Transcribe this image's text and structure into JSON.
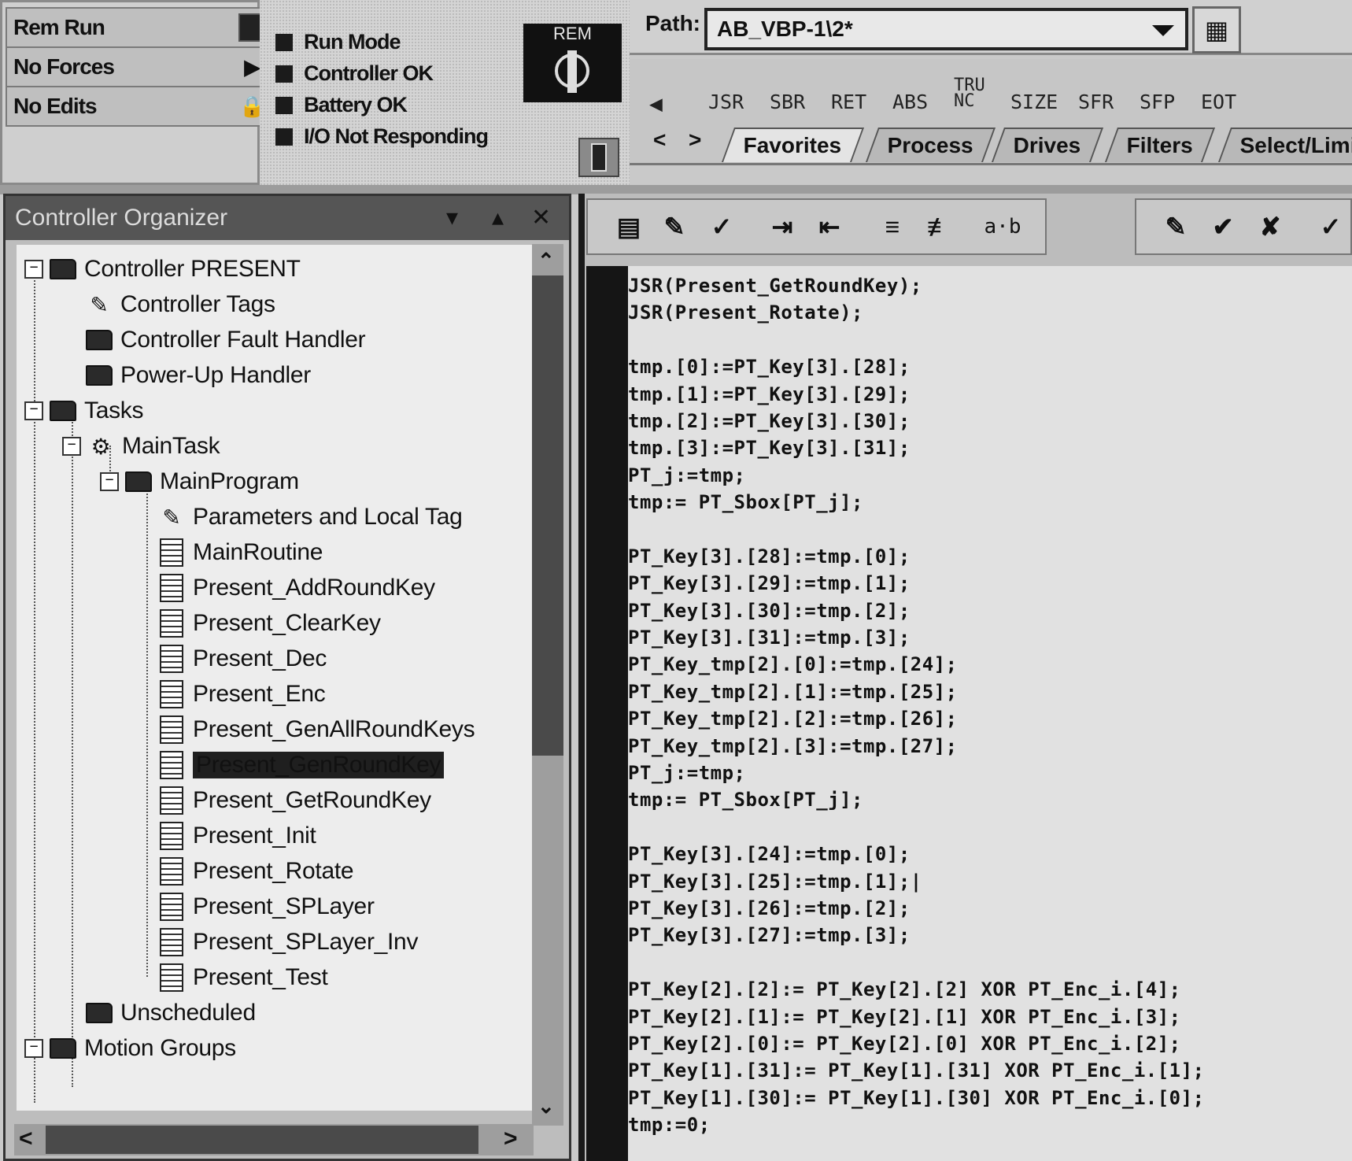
{
  "status": {
    "rem_run": "Rem Run",
    "no_forces": "No Forces",
    "no_edits": "No Edits",
    "indicators": [
      "Run Mode",
      "Controller OK",
      "Battery OK",
      "I/O Not Responding"
    ],
    "keyswitch_label": "REM"
  },
  "path": {
    "label": "Path:",
    "value": "AB_VBP-1\\2*"
  },
  "instructions": [
    "JSR",
    "SBR",
    "RET",
    "ABS",
    "SIZE",
    "SFR",
    "SFP",
    "EOT"
  ],
  "instruction_truncated": [
    "TRU",
    "NC"
  ],
  "tabs": [
    "Favorites",
    "Process",
    "Drives",
    "Filters",
    "Select/Limi"
  ],
  "organizer": {
    "title": "Controller Organizer",
    "tree": [
      {
        "label": "Controller PRESENT",
        "icon": "folder-icon"
      },
      {
        "label": "Controller Tags",
        "icon": "tags-icon"
      },
      {
        "label": "Controller Fault Handler",
        "icon": "folder-icon"
      },
      {
        "label": "Power-Up Handler",
        "icon": "folder-icon"
      },
      {
        "label": "Tasks",
        "icon": "folder-icon"
      },
      {
        "label": "MainTask",
        "icon": "task-icon"
      },
      {
        "label": "MainProgram",
        "icon": "program-icon"
      },
      {
        "label": "Parameters and Local Tag",
        "icon": "tags-icon"
      },
      {
        "label": "MainRoutine",
        "icon": "main-routine-icon"
      },
      {
        "label": "Present_AddRoundKey",
        "icon": "routine-icon"
      },
      {
        "label": "Present_ClearKey",
        "icon": "routine-icon"
      },
      {
        "label": "Present_Dec",
        "icon": "routine-icon"
      },
      {
        "label": "Present_Enc",
        "icon": "routine-icon"
      },
      {
        "label": "Present_GenAllRoundKeys",
        "icon": "routine-icon"
      },
      {
        "label": "Present_GenRoundKey",
        "icon": "routine-icon"
      },
      {
        "label": "Present_GetRoundKey",
        "icon": "routine-icon"
      },
      {
        "label": "Present_Init",
        "icon": "routine-icon"
      },
      {
        "label": "Present_Rotate",
        "icon": "routine-icon"
      },
      {
        "label": "Present_SPLayer",
        "icon": "routine-icon"
      },
      {
        "label": "Present_SPLayer_Inv",
        "icon": "routine-icon"
      },
      {
        "label": "Present_Test",
        "icon": "routine-icon"
      },
      {
        "label": "Unscheduled",
        "icon": "folder-icon"
      },
      {
        "label": "Motion Groups",
        "icon": "folder-icon"
      }
    ],
    "selected": "Present_GenRoundKey"
  },
  "editor": {
    "format_label": "a·b",
    "code": [
      "JSR(Present_GetRoundKey);",
      "JSR(Present_Rotate);",
      "",
      "tmp.[0]:=PT_Key[3].[28];",
      "tmp.[1]:=PT_Key[3].[29];",
      "tmp.[2]:=PT_Key[3].[30];",
      "tmp.[3]:=PT_Key[3].[31];",
      "PT_j:=tmp;",
      "tmp:= PT_Sbox[PT_j];",
      "",
      "PT_Key[3].[28]:=tmp.[0];",
      "PT_Key[3].[29]:=tmp.[1];",
      "PT_Key[3].[30]:=tmp.[2];",
      "PT_Key[3].[31]:=tmp.[3];",
      "PT_Key_tmp[2].[0]:=tmp.[24];",
      "PT_Key_tmp[2].[1]:=tmp.[25];",
      "PT_Key_tmp[2].[2]:=tmp.[26];",
      "PT_Key_tmp[2].[3]:=tmp.[27];",
      "PT_j:=tmp;",
      "tmp:= PT_Sbox[PT_j];",
      "",
      "PT_Key[3].[24]:=tmp.[0];",
      "PT_Key[3].[25]:=tmp.[1];|",
      "PT_Key[3].[26]:=tmp.[2];",
      "PT_Key[3].[27]:=tmp.[3];",
      "",
      "PT_Key[2].[2]:= PT_Key[2].[2] XOR PT_Enc_i.[4];",
      "PT_Key[2].[1]:= PT_Key[2].[1] XOR PT_Enc_i.[3];",
      "PT_Key[2].[0]:= PT_Key[2].[0] XOR PT_Enc_i.[2];",
      "PT_Key[1].[31]:= PT_Key[1].[31] XOR PT_Enc_i.[1];",
      "PT_Key[1].[30]:= PT_Key[1].[30] XOR PT_Enc_i.[0];",
      "tmp:=0;"
    ]
  }
}
